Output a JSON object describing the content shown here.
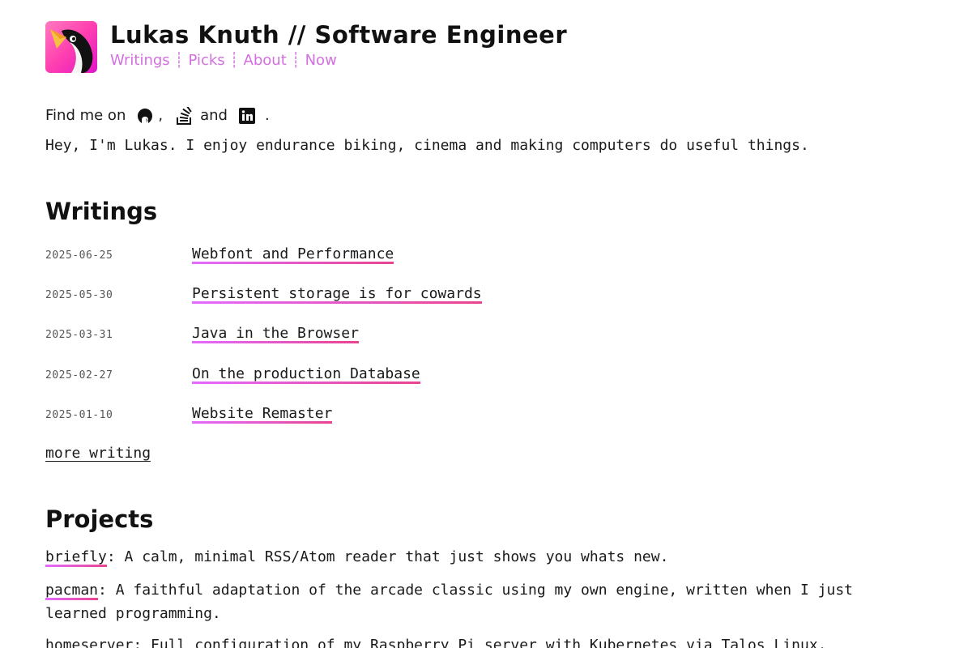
{
  "header": {
    "title": "Lukas Knuth // Software Engineer",
    "nav": [
      {
        "label": "Writings"
      },
      {
        "label": "Picks"
      },
      {
        "label": "About"
      },
      {
        "label": "Now"
      }
    ],
    "nav_separator": "┊",
    "accent_color": "#d46fe0",
    "logo_icon": "penguin-logo-icon"
  },
  "intro": {
    "find_me_prefix": "Find me on",
    "comma": ",",
    "and": "and",
    "period": ".",
    "socials": [
      {
        "icon": "github-icon"
      },
      {
        "icon": "stackoverflow-icon"
      },
      {
        "icon": "linkedin-icon"
      }
    ],
    "text": "Hey, I'm Lukas. I enjoy endurance biking, cinema and making computers do useful things."
  },
  "writings": {
    "heading": "Writings",
    "items": [
      {
        "date": "2025-06-25",
        "title": "Webfont and Performance"
      },
      {
        "date": "2025-05-30",
        "title": "Persistent storage is for cowards"
      },
      {
        "date": "2025-03-31",
        "title": "Java in the Browser"
      },
      {
        "date": "2025-02-27",
        "title": "On the production Database"
      },
      {
        "date": "2025-01-10",
        "title": "Website Remaster"
      }
    ],
    "more": "more writing",
    "link_gradient": [
      "#e36bff",
      "#e8448f"
    ]
  },
  "projects": {
    "heading": "Projects",
    "items": [
      {
        "name": "briefly",
        "description": ": A calm, minimal RSS/Atom reader that just shows you whats new."
      },
      {
        "name": "pacman",
        "description": ": A faithful adaptation of the arcade classic using my own engine, written when I just learned programming."
      },
      {
        "name": "homeserver",
        "description": ": Full configuration of my Raspberry Pi server with Kubernetes via Talos Linux."
      }
    ]
  }
}
